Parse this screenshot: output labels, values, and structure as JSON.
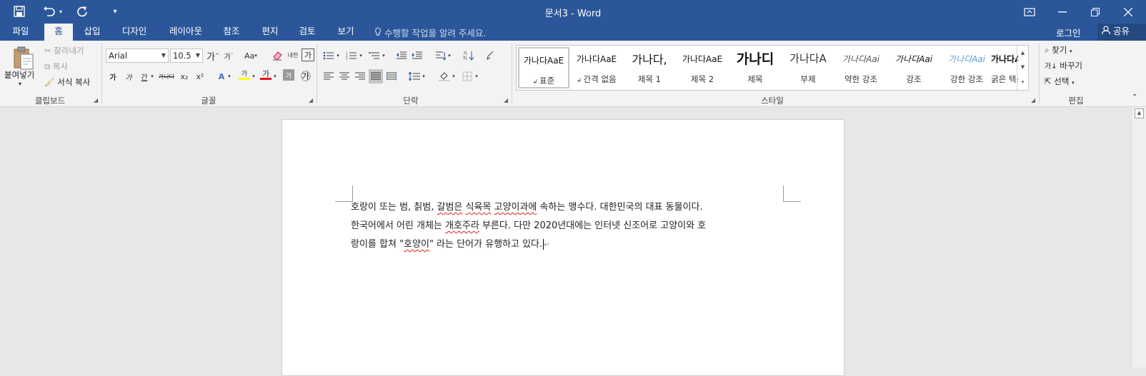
{
  "window": {
    "title": "문서3 - Word"
  },
  "tabs": [
    "파일",
    "홈",
    "삽입",
    "디자인",
    "레이아웃",
    "참조",
    "편지",
    "검토",
    "보기"
  ],
  "active_tab": "홈",
  "tell_me": "수행할 작업을 알려 주세요.",
  "account": {
    "sign_in": "로그인",
    "share": "공유"
  },
  "clipboard": {
    "paste": "붙여넣기",
    "cut": "잘라내기",
    "copy": "복사",
    "format_painter": "서식 복사",
    "label": "클립보드"
  },
  "font": {
    "family": "Arial",
    "size": "10.5",
    "grow": "가",
    "shrink": "가",
    "change_case": "Aa",
    "bold": "가",
    "italic": "가",
    "underline": "간",
    "strike": "가나다",
    "subscript": "x₂",
    "superscript": "x²",
    "char_shading": "가",
    "enclose": "㉮",
    "phonetic": "내천",
    "border_char": "가",
    "highlight": "가",
    "font_color": "가",
    "label": "글꼴",
    "highlight_color": "#ffff00",
    "font_color_value": "#e81123"
  },
  "paragraph": {
    "label": "단락"
  },
  "styles": {
    "label": "스타일",
    "items": [
      {
        "preview": "가나다AaE",
        "name": "표준"
      },
      {
        "preview": "가나다AaE",
        "name": "간격 없음"
      },
      {
        "preview": "가나다,",
        "name": "제목 1"
      },
      {
        "preview": "가나다AaE",
        "name": "제목 2"
      },
      {
        "preview": "가나디",
        "name": "제목"
      },
      {
        "preview": "가나다A",
        "name": "부제"
      },
      {
        "preview": "가나다Aai",
        "name": "약한 강조"
      },
      {
        "preview": "가나다Aai",
        "name": "강조"
      },
      {
        "preview": "가나다Aai",
        "name": "강한 강조"
      },
      {
        "preview": "가나다AaE",
        "name": "굵은 텍스트"
      }
    ]
  },
  "editing": {
    "find": "찾기",
    "replace": "바꾸기",
    "select": "선택",
    "label": "편집"
  },
  "document": {
    "line1": {
      "a": "호랑이 또는 범, 칡범, ",
      "b": "갈범은",
      "c": " ",
      "d": "식육목",
      "e": " ",
      "f": "고양이과에",
      "g": " 속하는 맹수다. 대한민국의 대표 동물이다."
    },
    "line2": {
      "a": "한국어에서 어린 개체는 ",
      "b": "개호주라",
      "c": " 부른다. 다만 2020년대에는 인터넷 신조어로 고양이와 호"
    },
    "line3": {
      "a": "랑이를 합쳐 \"",
      "b": "호양이",
      "c": "\" 라는 단어가 유행하고 있다.",
      "mark": "↵"
    }
  }
}
